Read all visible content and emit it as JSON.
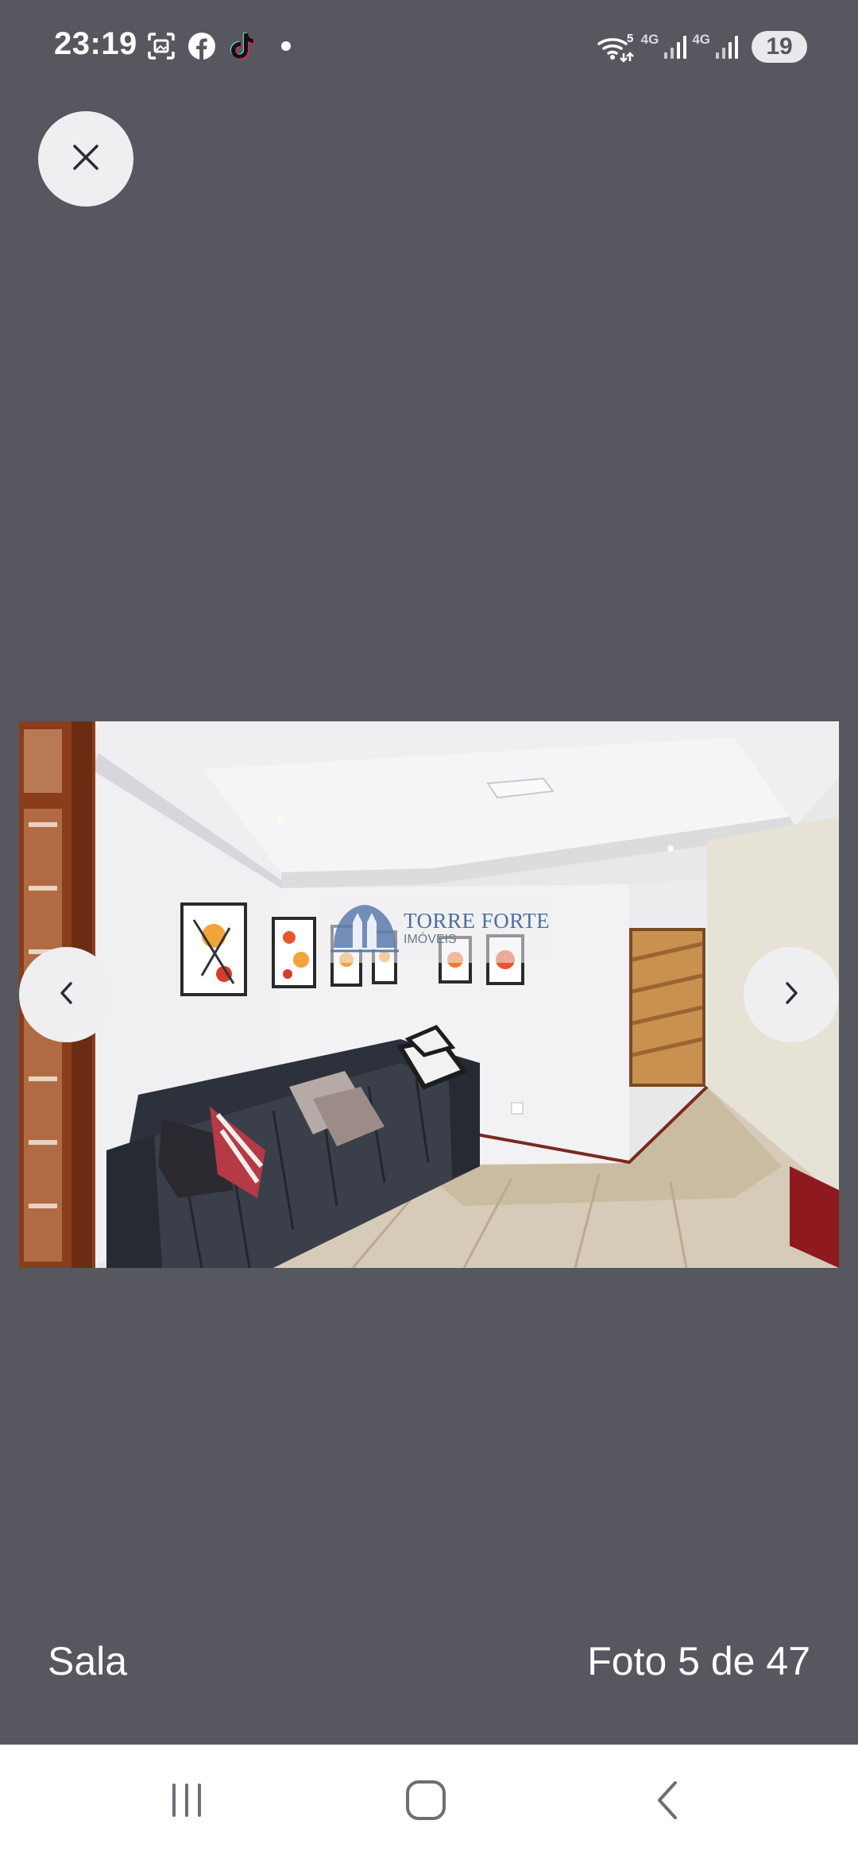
{
  "status_bar": {
    "time": "23:19",
    "network_labels": [
      "4G",
      "4G"
    ],
    "wifi_badge": "5",
    "battery": "19"
  },
  "viewer": {
    "watermark": {
      "brand": "TORRE FORTE",
      "subtitle": "IMÓVEIS"
    }
  },
  "caption": {
    "title": "Sala",
    "counter": "Foto 5 de 47"
  },
  "colors": {
    "background": "#575760",
    "button_bg": "#efeff1",
    "nav_bar": "#ffffff",
    "nav_icons": "#6d6d75",
    "watermark_blue": "#4f6e9f"
  },
  "icons": {
    "close": "close-icon",
    "prev": "chevron-left-icon",
    "next": "chevron-right-icon",
    "recents": "recents-icon",
    "home": "home-icon",
    "back": "back-icon"
  }
}
